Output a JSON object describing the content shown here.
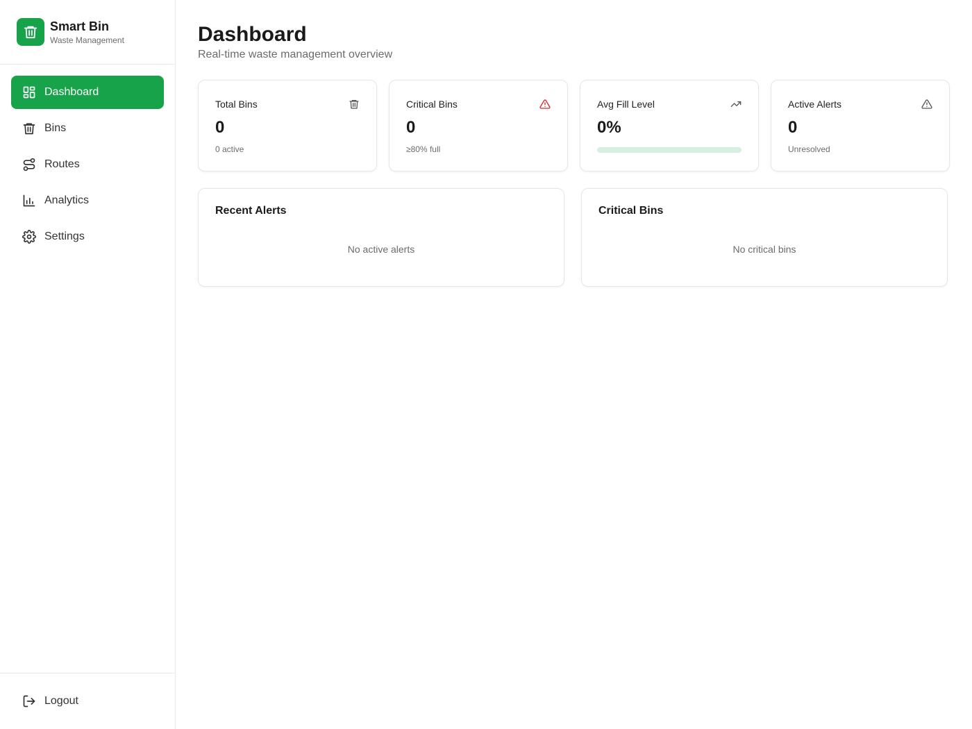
{
  "brand": {
    "title": "Smart Bin",
    "subtitle": "Waste Management",
    "logo_icon": "trash-icon",
    "accent": "#16a34a"
  },
  "nav": [
    {
      "label": "Dashboard",
      "icon": "dashboard-icon",
      "active": true
    },
    {
      "label": "Bins",
      "icon": "trash-icon",
      "active": false
    },
    {
      "label": "Routes",
      "icon": "route-icon",
      "active": false
    },
    {
      "label": "Analytics",
      "icon": "bar-chart-icon",
      "active": false
    },
    {
      "label": "Settings",
      "icon": "gear-icon",
      "active": false
    }
  ],
  "logout": {
    "label": "Logout",
    "icon": "logout-icon"
  },
  "header": {
    "title": "Dashboard",
    "subtitle": "Real-time waste management overview"
  },
  "stats": {
    "total_bins": {
      "title": "Total Bins",
      "value": "0",
      "note": "0 active",
      "icon": "trash-icon"
    },
    "critical_bins": {
      "title": "Critical Bins",
      "value": "0",
      "note": "≥80% full",
      "icon": "warning-triangle-icon",
      "icon_color": "#dc2626"
    },
    "avg_fill": {
      "title": "Avg Fill Level",
      "value": "0%",
      "progress": 0,
      "icon": "trending-up-icon"
    },
    "active_alerts": {
      "title": "Active Alerts",
      "value": "0",
      "note": "Unresolved",
      "icon": "warning-triangle-icon"
    }
  },
  "panels": {
    "recent_alerts": {
      "title": "Recent Alerts",
      "empty": "No active alerts"
    },
    "critical_bins": {
      "title": "Critical Bins",
      "empty": "No critical bins"
    }
  }
}
